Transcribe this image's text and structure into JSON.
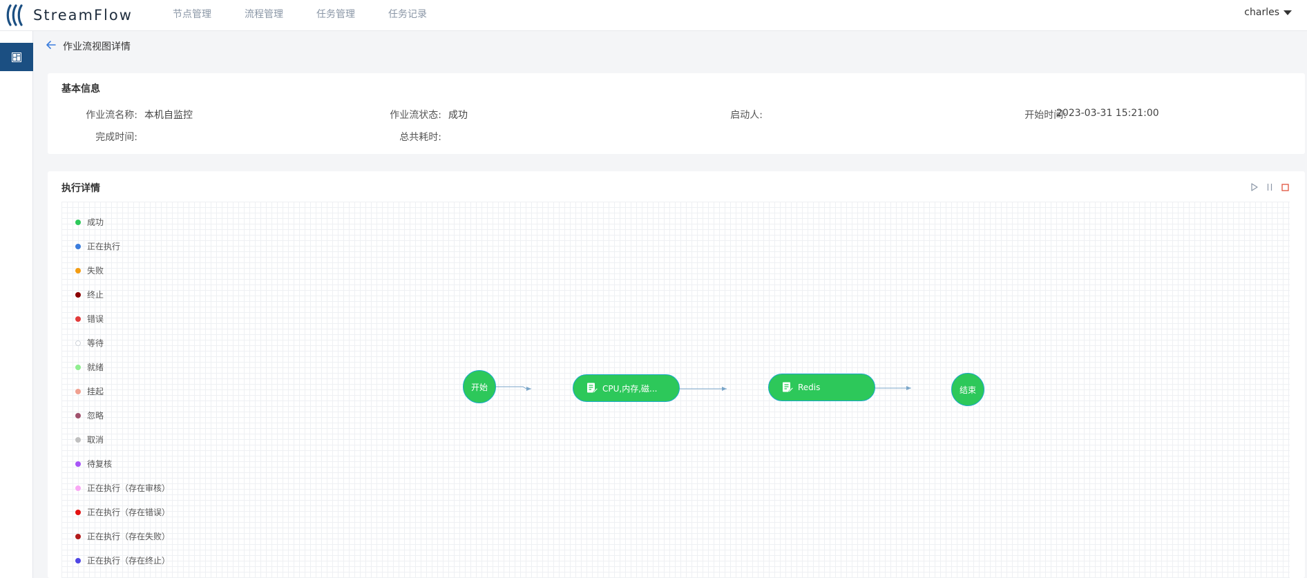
{
  "app": {
    "brand": "StreamFlow",
    "user": "charles"
  },
  "nav": {
    "items": [
      {
        "label": "节点管理"
      },
      {
        "label": "流程管理"
      },
      {
        "label": "任务管理"
      },
      {
        "label": "任务记录"
      }
    ]
  },
  "page": {
    "title": "作业流视图详情"
  },
  "basic_info": {
    "title": "基本信息",
    "fields": [
      {
        "label": "作业流名称:",
        "value": "本机自监控"
      },
      {
        "label": "作业流状态:",
        "value": "成功"
      },
      {
        "label": "启动人:",
        "value": ""
      },
      {
        "label": "开始时间:",
        "value": "2023-03-31 15:21:00"
      },
      {
        "label": "完成时间:",
        "value": ""
      },
      {
        "label": "总共耗时:",
        "value": ""
      }
    ]
  },
  "execution": {
    "title": "执行详情",
    "controls": [
      {
        "name": "play-icon",
        "color": "#8a96a6"
      },
      {
        "name": "pause-icon",
        "color": "#8a96a6"
      },
      {
        "name": "stop-icon",
        "color": "#e0523c"
      }
    ],
    "legend": [
      {
        "label": "成功",
        "color": "#2dc85a"
      },
      {
        "label": "正在执行",
        "color": "#3b7ddd"
      },
      {
        "label": "失败",
        "color": "#f39c12"
      },
      {
        "label": "终止",
        "color": "#8b0000"
      },
      {
        "label": "错误",
        "color": "#e23b3b"
      },
      {
        "label": "等待",
        "color": "#ffffff",
        "outline": "#cfd4da"
      },
      {
        "label": "就绪",
        "color": "#90ee90"
      },
      {
        "label": "挂起",
        "color": "#f0a090"
      },
      {
        "label": "忽略",
        "color": "#a0526d"
      },
      {
        "label": "取消",
        "color": "#c0c0c0"
      },
      {
        "label": "待复核",
        "color": "#a855f7"
      },
      {
        "label": "正在执行（存在审核）",
        "color": "#f9a8f4"
      },
      {
        "label": "正在执行（存在错误）",
        "color": "#e31212"
      },
      {
        "label": "正在执行（存在失败）",
        "color": "#b11a1a"
      },
      {
        "label": "正在执行（存在终止）",
        "color": "#4f46e5"
      }
    ],
    "nodes": [
      {
        "label": "开始",
        "shape": "circle",
        "status": "成功"
      },
      {
        "label": "CPU,内存,磁...",
        "shape": "task",
        "status": "成功"
      },
      {
        "label": "Redis",
        "shape": "task",
        "status": "成功"
      },
      {
        "label": "结束",
        "shape": "circle",
        "status": "成功"
      }
    ],
    "node_color": "#2dc85a",
    "edge_color": "#7aa6c9"
  }
}
